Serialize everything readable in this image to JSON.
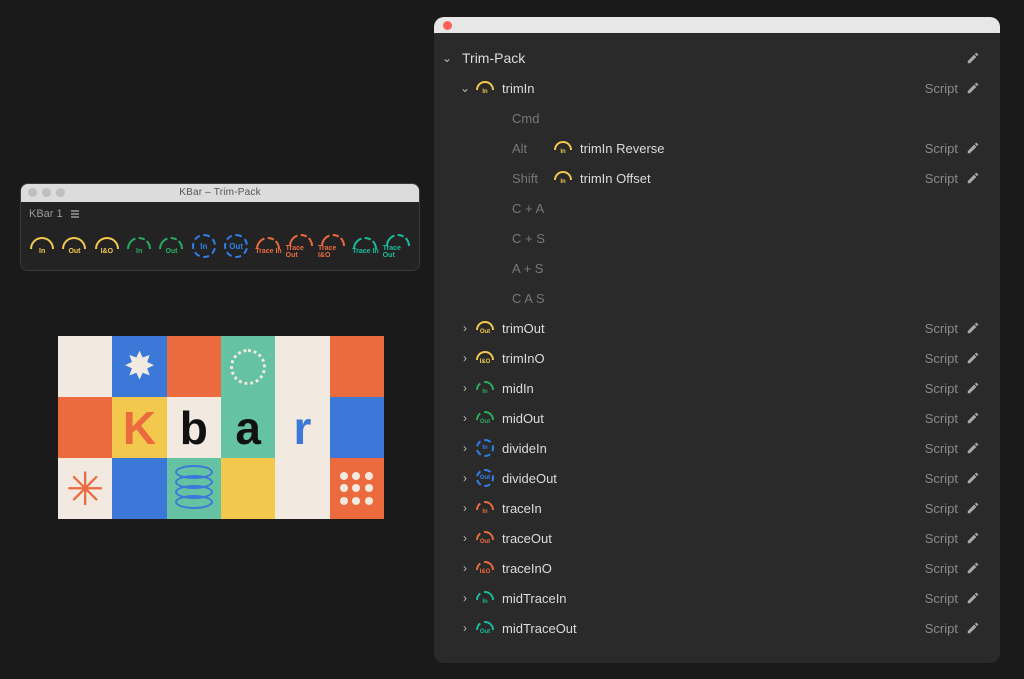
{
  "kbar_window": {
    "title": "KBar – Trim-Pack",
    "tab_label": "KBar 1",
    "buttons": [
      {
        "label": "In",
        "color": "c-yellow",
        "shape": "arc",
        "name": "kbar-btn-trimIn"
      },
      {
        "label": "Out",
        "color": "c-yellow",
        "shape": "arc",
        "name": "kbar-btn-trimOut"
      },
      {
        "label": "I&O",
        "color": "c-yellow",
        "shape": "arc",
        "name": "kbar-btn-trimInO"
      },
      {
        "label": "In",
        "color": "c-green",
        "shape": "arc-d",
        "name": "kbar-btn-midIn"
      },
      {
        "label": "Out",
        "color": "c-green",
        "shape": "arc-d",
        "name": "kbar-btn-midOut"
      },
      {
        "label": "In",
        "color": "c-blue",
        "shape": "circ",
        "name": "kbar-btn-divideIn"
      },
      {
        "label": "Out",
        "color": "c-blue",
        "shape": "circ",
        "name": "kbar-btn-divideOut"
      },
      {
        "label": "Trace In",
        "color": "c-orange",
        "shape": "arc-d",
        "name": "kbar-btn-traceIn"
      },
      {
        "label": "Trace Out",
        "color": "c-orange",
        "shape": "arc-d",
        "name": "kbar-btn-traceOut"
      },
      {
        "label": "Trace I&O",
        "color": "c-orange",
        "shape": "arc-d",
        "name": "kbar-btn-traceInO"
      },
      {
        "label": "Trace In",
        "color": "c-teal",
        "shape": "arc-d",
        "name": "kbar-btn-midTraceIn"
      },
      {
        "label": "Trace Out",
        "color": "c-teal",
        "shape": "arc-d",
        "name": "kbar-btn-midTraceOut"
      }
    ]
  },
  "settings": {
    "pack_title": "Trim-Pack",
    "type_label": "Script",
    "modifiers": {
      "cmd": "Cmd",
      "alt": "Alt",
      "shift": "Shift",
      "ca": "C + A",
      "cs": "C + S",
      "as": "A + S",
      "cas": "C A S"
    },
    "selected": {
      "label": "trimIn",
      "icon": {
        "color": "c-yellow",
        "shape": "arc",
        "label": "In"
      },
      "alt": {
        "label": "trimIn Reverse",
        "icon": {
          "color": "c-yellow",
          "shape": "arc",
          "label": "In"
        }
      },
      "shift": {
        "label": "trimIn Offset",
        "icon": {
          "color": "c-yellow",
          "shape": "arc",
          "label": "In"
        }
      }
    },
    "items": [
      {
        "label": "trimOut",
        "icon": {
          "color": "c-yellow",
          "shape": "arc",
          "label": "Out"
        }
      },
      {
        "label": "trimInO",
        "icon": {
          "color": "c-yellow",
          "shape": "arc",
          "label": "I&O"
        }
      },
      {
        "label": "midIn",
        "icon": {
          "color": "c-green",
          "shape": "arc-d",
          "label": "In"
        }
      },
      {
        "label": "midOut",
        "icon": {
          "color": "c-green",
          "shape": "arc-d",
          "label": "Out"
        }
      },
      {
        "label": "divideIn",
        "icon": {
          "color": "c-blue",
          "shape": "circ",
          "label": "In"
        }
      },
      {
        "label": "divideOut",
        "icon": {
          "color": "c-blue",
          "shape": "circ",
          "label": "Out"
        }
      },
      {
        "label": "traceIn",
        "icon": {
          "color": "c-orange",
          "shape": "arc-d",
          "label": "In"
        }
      },
      {
        "label": "traceOut",
        "icon": {
          "color": "c-orange",
          "shape": "arc-d",
          "label": "Out"
        }
      },
      {
        "label": "traceInO",
        "icon": {
          "color": "c-orange",
          "shape": "arc-d",
          "label": "I&O"
        }
      },
      {
        "label": "midTraceIn",
        "icon": {
          "color": "c-teal",
          "shape": "arc-d",
          "label": "In"
        }
      },
      {
        "label": "midTraceOut",
        "icon": {
          "color": "c-teal",
          "shape": "arc-d",
          "label": "Out"
        }
      }
    ]
  }
}
